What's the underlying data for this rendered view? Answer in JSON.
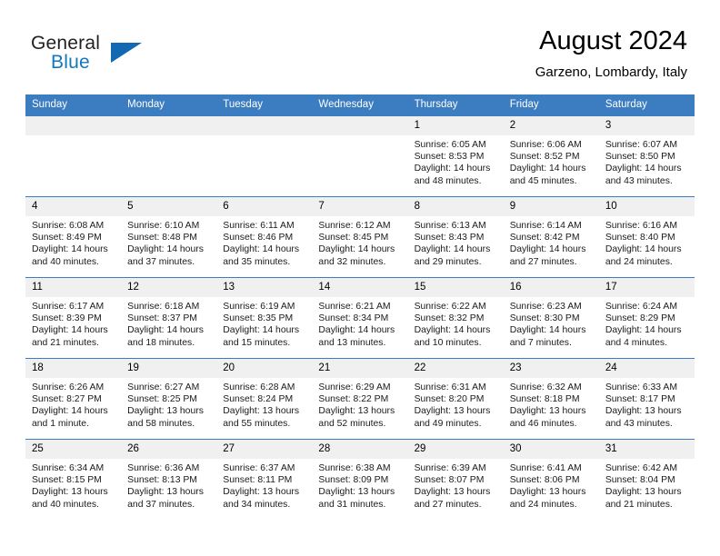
{
  "brand": {
    "name_top": "General",
    "name_bottom": "Blue",
    "triangle_color": "#1268b3",
    "text_color": "#231f20",
    "blue_color": "#1278be"
  },
  "header": {
    "title": "August 2024",
    "subtitle": "Garzeno, Lombardy, Italy",
    "accent_color": "#3b7dc0",
    "daynum_band_color": "#f0f0f0"
  },
  "weekdays": [
    "Sunday",
    "Monday",
    "Tuesday",
    "Wednesday",
    "Thursday",
    "Friday",
    "Saturday"
  ],
  "labels": {
    "sunrise_prefix": "Sunrise:",
    "sunset_prefix": "Sunset:",
    "daylight_prefix": "Daylight:"
  },
  "weeks": [
    [
      {
        "day": "",
        "blank": true
      },
      {
        "day": "",
        "blank": true
      },
      {
        "day": "",
        "blank": true
      },
      {
        "day": "",
        "blank": true
      },
      {
        "day": "1",
        "sunrise": "Sunrise: 6:05 AM",
        "sunset": "Sunset: 8:53 PM",
        "daylight1": "Daylight: 14 hours",
        "daylight2": "and 48 minutes."
      },
      {
        "day": "2",
        "sunrise": "Sunrise: 6:06 AM",
        "sunset": "Sunset: 8:52 PM",
        "daylight1": "Daylight: 14 hours",
        "daylight2": "and 45 minutes."
      },
      {
        "day": "3",
        "sunrise": "Sunrise: 6:07 AM",
        "sunset": "Sunset: 8:50 PM",
        "daylight1": "Daylight: 14 hours",
        "daylight2": "and 43 minutes."
      }
    ],
    [
      {
        "day": "4",
        "sunrise": "Sunrise: 6:08 AM",
        "sunset": "Sunset: 8:49 PM",
        "daylight1": "Daylight: 14 hours",
        "daylight2": "and 40 minutes."
      },
      {
        "day": "5",
        "sunrise": "Sunrise: 6:10 AM",
        "sunset": "Sunset: 8:48 PM",
        "daylight1": "Daylight: 14 hours",
        "daylight2": "and 37 minutes."
      },
      {
        "day": "6",
        "sunrise": "Sunrise: 6:11 AM",
        "sunset": "Sunset: 8:46 PM",
        "daylight1": "Daylight: 14 hours",
        "daylight2": "and 35 minutes."
      },
      {
        "day": "7",
        "sunrise": "Sunrise: 6:12 AM",
        "sunset": "Sunset: 8:45 PM",
        "daylight1": "Daylight: 14 hours",
        "daylight2": "and 32 minutes."
      },
      {
        "day": "8",
        "sunrise": "Sunrise: 6:13 AM",
        "sunset": "Sunset: 8:43 PM",
        "daylight1": "Daylight: 14 hours",
        "daylight2": "and 29 minutes."
      },
      {
        "day": "9",
        "sunrise": "Sunrise: 6:14 AM",
        "sunset": "Sunset: 8:42 PM",
        "daylight1": "Daylight: 14 hours",
        "daylight2": "and 27 minutes."
      },
      {
        "day": "10",
        "sunrise": "Sunrise: 6:16 AM",
        "sunset": "Sunset: 8:40 PM",
        "daylight1": "Daylight: 14 hours",
        "daylight2": "and 24 minutes."
      }
    ],
    [
      {
        "day": "11",
        "sunrise": "Sunrise: 6:17 AM",
        "sunset": "Sunset: 8:39 PM",
        "daylight1": "Daylight: 14 hours",
        "daylight2": "and 21 minutes."
      },
      {
        "day": "12",
        "sunrise": "Sunrise: 6:18 AM",
        "sunset": "Sunset: 8:37 PM",
        "daylight1": "Daylight: 14 hours",
        "daylight2": "and 18 minutes."
      },
      {
        "day": "13",
        "sunrise": "Sunrise: 6:19 AM",
        "sunset": "Sunset: 8:35 PM",
        "daylight1": "Daylight: 14 hours",
        "daylight2": "and 15 minutes."
      },
      {
        "day": "14",
        "sunrise": "Sunrise: 6:21 AM",
        "sunset": "Sunset: 8:34 PM",
        "daylight1": "Daylight: 14 hours",
        "daylight2": "and 13 minutes."
      },
      {
        "day": "15",
        "sunrise": "Sunrise: 6:22 AM",
        "sunset": "Sunset: 8:32 PM",
        "daylight1": "Daylight: 14 hours",
        "daylight2": "and 10 minutes."
      },
      {
        "day": "16",
        "sunrise": "Sunrise: 6:23 AM",
        "sunset": "Sunset: 8:30 PM",
        "daylight1": "Daylight: 14 hours",
        "daylight2": "and 7 minutes."
      },
      {
        "day": "17",
        "sunrise": "Sunrise: 6:24 AM",
        "sunset": "Sunset: 8:29 PM",
        "daylight1": "Daylight: 14 hours",
        "daylight2": "and 4 minutes."
      }
    ],
    [
      {
        "day": "18",
        "sunrise": "Sunrise: 6:26 AM",
        "sunset": "Sunset: 8:27 PM",
        "daylight1": "Daylight: 14 hours",
        "daylight2": "and 1 minute."
      },
      {
        "day": "19",
        "sunrise": "Sunrise: 6:27 AM",
        "sunset": "Sunset: 8:25 PM",
        "daylight1": "Daylight: 13 hours",
        "daylight2": "and 58 minutes."
      },
      {
        "day": "20",
        "sunrise": "Sunrise: 6:28 AM",
        "sunset": "Sunset: 8:24 PM",
        "daylight1": "Daylight: 13 hours",
        "daylight2": "and 55 minutes."
      },
      {
        "day": "21",
        "sunrise": "Sunrise: 6:29 AM",
        "sunset": "Sunset: 8:22 PM",
        "daylight1": "Daylight: 13 hours",
        "daylight2": "and 52 minutes."
      },
      {
        "day": "22",
        "sunrise": "Sunrise: 6:31 AM",
        "sunset": "Sunset: 8:20 PM",
        "daylight1": "Daylight: 13 hours",
        "daylight2": "and 49 minutes."
      },
      {
        "day": "23",
        "sunrise": "Sunrise: 6:32 AM",
        "sunset": "Sunset: 8:18 PM",
        "daylight1": "Daylight: 13 hours",
        "daylight2": "and 46 minutes."
      },
      {
        "day": "24",
        "sunrise": "Sunrise: 6:33 AM",
        "sunset": "Sunset: 8:17 PM",
        "daylight1": "Daylight: 13 hours",
        "daylight2": "and 43 minutes."
      }
    ],
    [
      {
        "day": "25",
        "sunrise": "Sunrise: 6:34 AM",
        "sunset": "Sunset: 8:15 PM",
        "daylight1": "Daylight: 13 hours",
        "daylight2": "and 40 minutes."
      },
      {
        "day": "26",
        "sunrise": "Sunrise: 6:36 AM",
        "sunset": "Sunset: 8:13 PM",
        "daylight1": "Daylight: 13 hours",
        "daylight2": "and 37 minutes."
      },
      {
        "day": "27",
        "sunrise": "Sunrise: 6:37 AM",
        "sunset": "Sunset: 8:11 PM",
        "daylight1": "Daylight: 13 hours",
        "daylight2": "and 34 minutes."
      },
      {
        "day": "28",
        "sunrise": "Sunrise: 6:38 AM",
        "sunset": "Sunset: 8:09 PM",
        "daylight1": "Daylight: 13 hours",
        "daylight2": "and 31 minutes."
      },
      {
        "day": "29",
        "sunrise": "Sunrise: 6:39 AM",
        "sunset": "Sunset: 8:07 PM",
        "daylight1": "Daylight: 13 hours",
        "daylight2": "and 27 minutes."
      },
      {
        "day": "30",
        "sunrise": "Sunrise: 6:41 AM",
        "sunset": "Sunset: 8:06 PM",
        "daylight1": "Daylight: 13 hours",
        "daylight2": "and 24 minutes."
      },
      {
        "day": "31",
        "sunrise": "Sunrise: 6:42 AM",
        "sunset": "Sunset: 8:04 PM",
        "daylight1": "Daylight: 13 hours",
        "daylight2": "and 21 minutes."
      }
    ]
  ]
}
